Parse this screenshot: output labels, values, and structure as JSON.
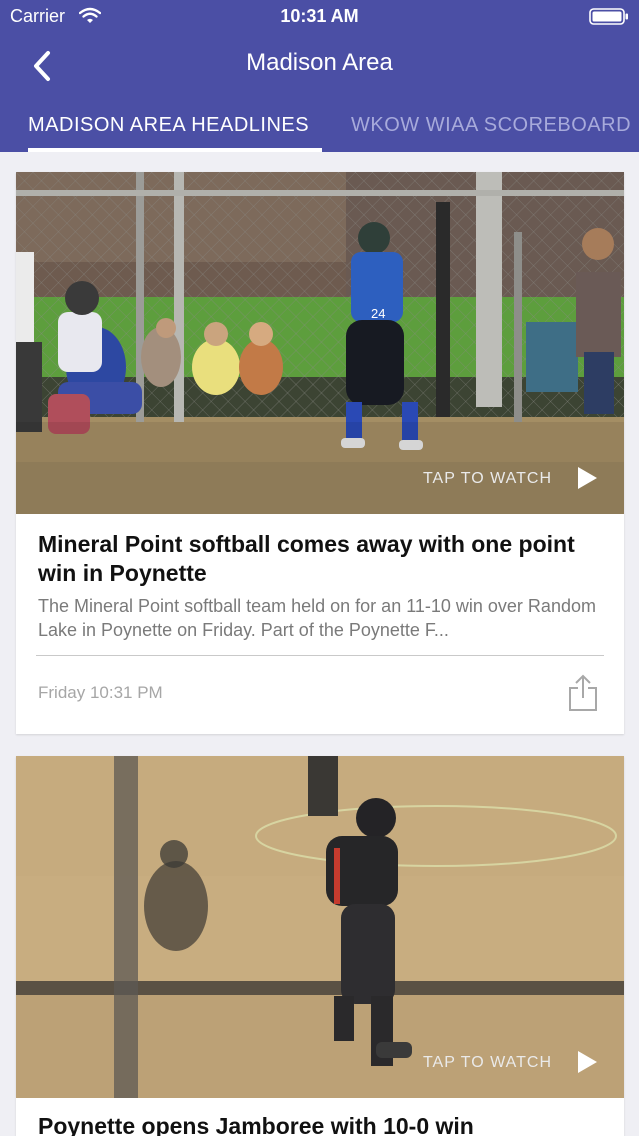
{
  "status_bar": {
    "carrier": "Carrier",
    "time": "10:31 AM"
  },
  "nav": {
    "title": "Madison Area"
  },
  "tabs": [
    {
      "label": "MADISON AREA HEADLINES"
    },
    {
      "label": "WKOW WIAA SCOREBOARD"
    }
  ],
  "articles": [
    {
      "tap_label": "TAP TO WATCH",
      "headline": "Mineral Point softball comes away with one point win in Poynette",
      "summary": "The Mineral Point softball team held on for an 11-10 win over Random Lake in Poynette on Friday. Part of the Poynette F...",
      "timestamp": "Friday 10:31 PM"
    },
    {
      "tap_label": "TAP TO WATCH",
      "headline": "Poynette opens Jamboree with 10-0 win"
    }
  ],
  "colors": {
    "header": "#4b4fa5",
    "tab_inactive": "#a7aadb",
    "background": "#efeff4"
  }
}
